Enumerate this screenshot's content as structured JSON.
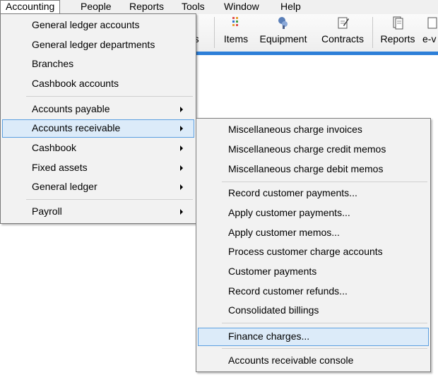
{
  "menubar": {
    "items": [
      {
        "label": "Accounting"
      },
      {
        "label": "People"
      },
      {
        "label": "Reports"
      },
      {
        "label": "Tools"
      },
      {
        "label": "Window"
      },
      {
        "label": "Help"
      }
    ]
  },
  "toolbar": {
    "partial_left_label": "rs",
    "items": [
      {
        "label": "Items",
        "icon": "items-grid-icon"
      },
      {
        "label": "Equipment",
        "icon": "equipment-icon"
      },
      {
        "label": "Contracts",
        "icon": "contracts-icon"
      },
      {
        "label": "Reports",
        "icon": "reports-icon"
      },
      {
        "label": "e-v",
        "icon": "e-v-icon"
      }
    ],
    "accent_color": "#2d7fd8"
  },
  "accounting_menu": {
    "items": [
      {
        "label": "General ledger accounts"
      },
      {
        "label": "General ledger departments"
      },
      {
        "label": "Branches"
      },
      {
        "label": "Cashbook accounts"
      },
      {
        "label": "Accounts payable"
      },
      {
        "label": "Accounts receivable"
      },
      {
        "label": "Cashbook"
      },
      {
        "label": "Fixed assets"
      },
      {
        "label": "General ledger"
      },
      {
        "label": "Payroll"
      }
    ]
  },
  "receivable_submenu": {
    "items": [
      {
        "label": "Miscellaneous charge invoices"
      },
      {
        "label": "Miscellaneous charge credit memos"
      },
      {
        "label": "Miscellaneous charge debit memos"
      },
      {
        "label": "Record customer payments..."
      },
      {
        "label": "Apply customer payments..."
      },
      {
        "label": "Apply customer memos..."
      },
      {
        "label": "Process customer charge accounts"
      },
      {
        "label": "Customer payments"
      },
      {
        "label": "Record customer refunds..."
      },
      {
        "label": "Consolidated billings"
      },
      {
        "label": "Finance charges..."
      },
      {
        "label": "Accounts receivable console"
      }
    ]
  },
  "highlight_color": "#dcebf9"
}
